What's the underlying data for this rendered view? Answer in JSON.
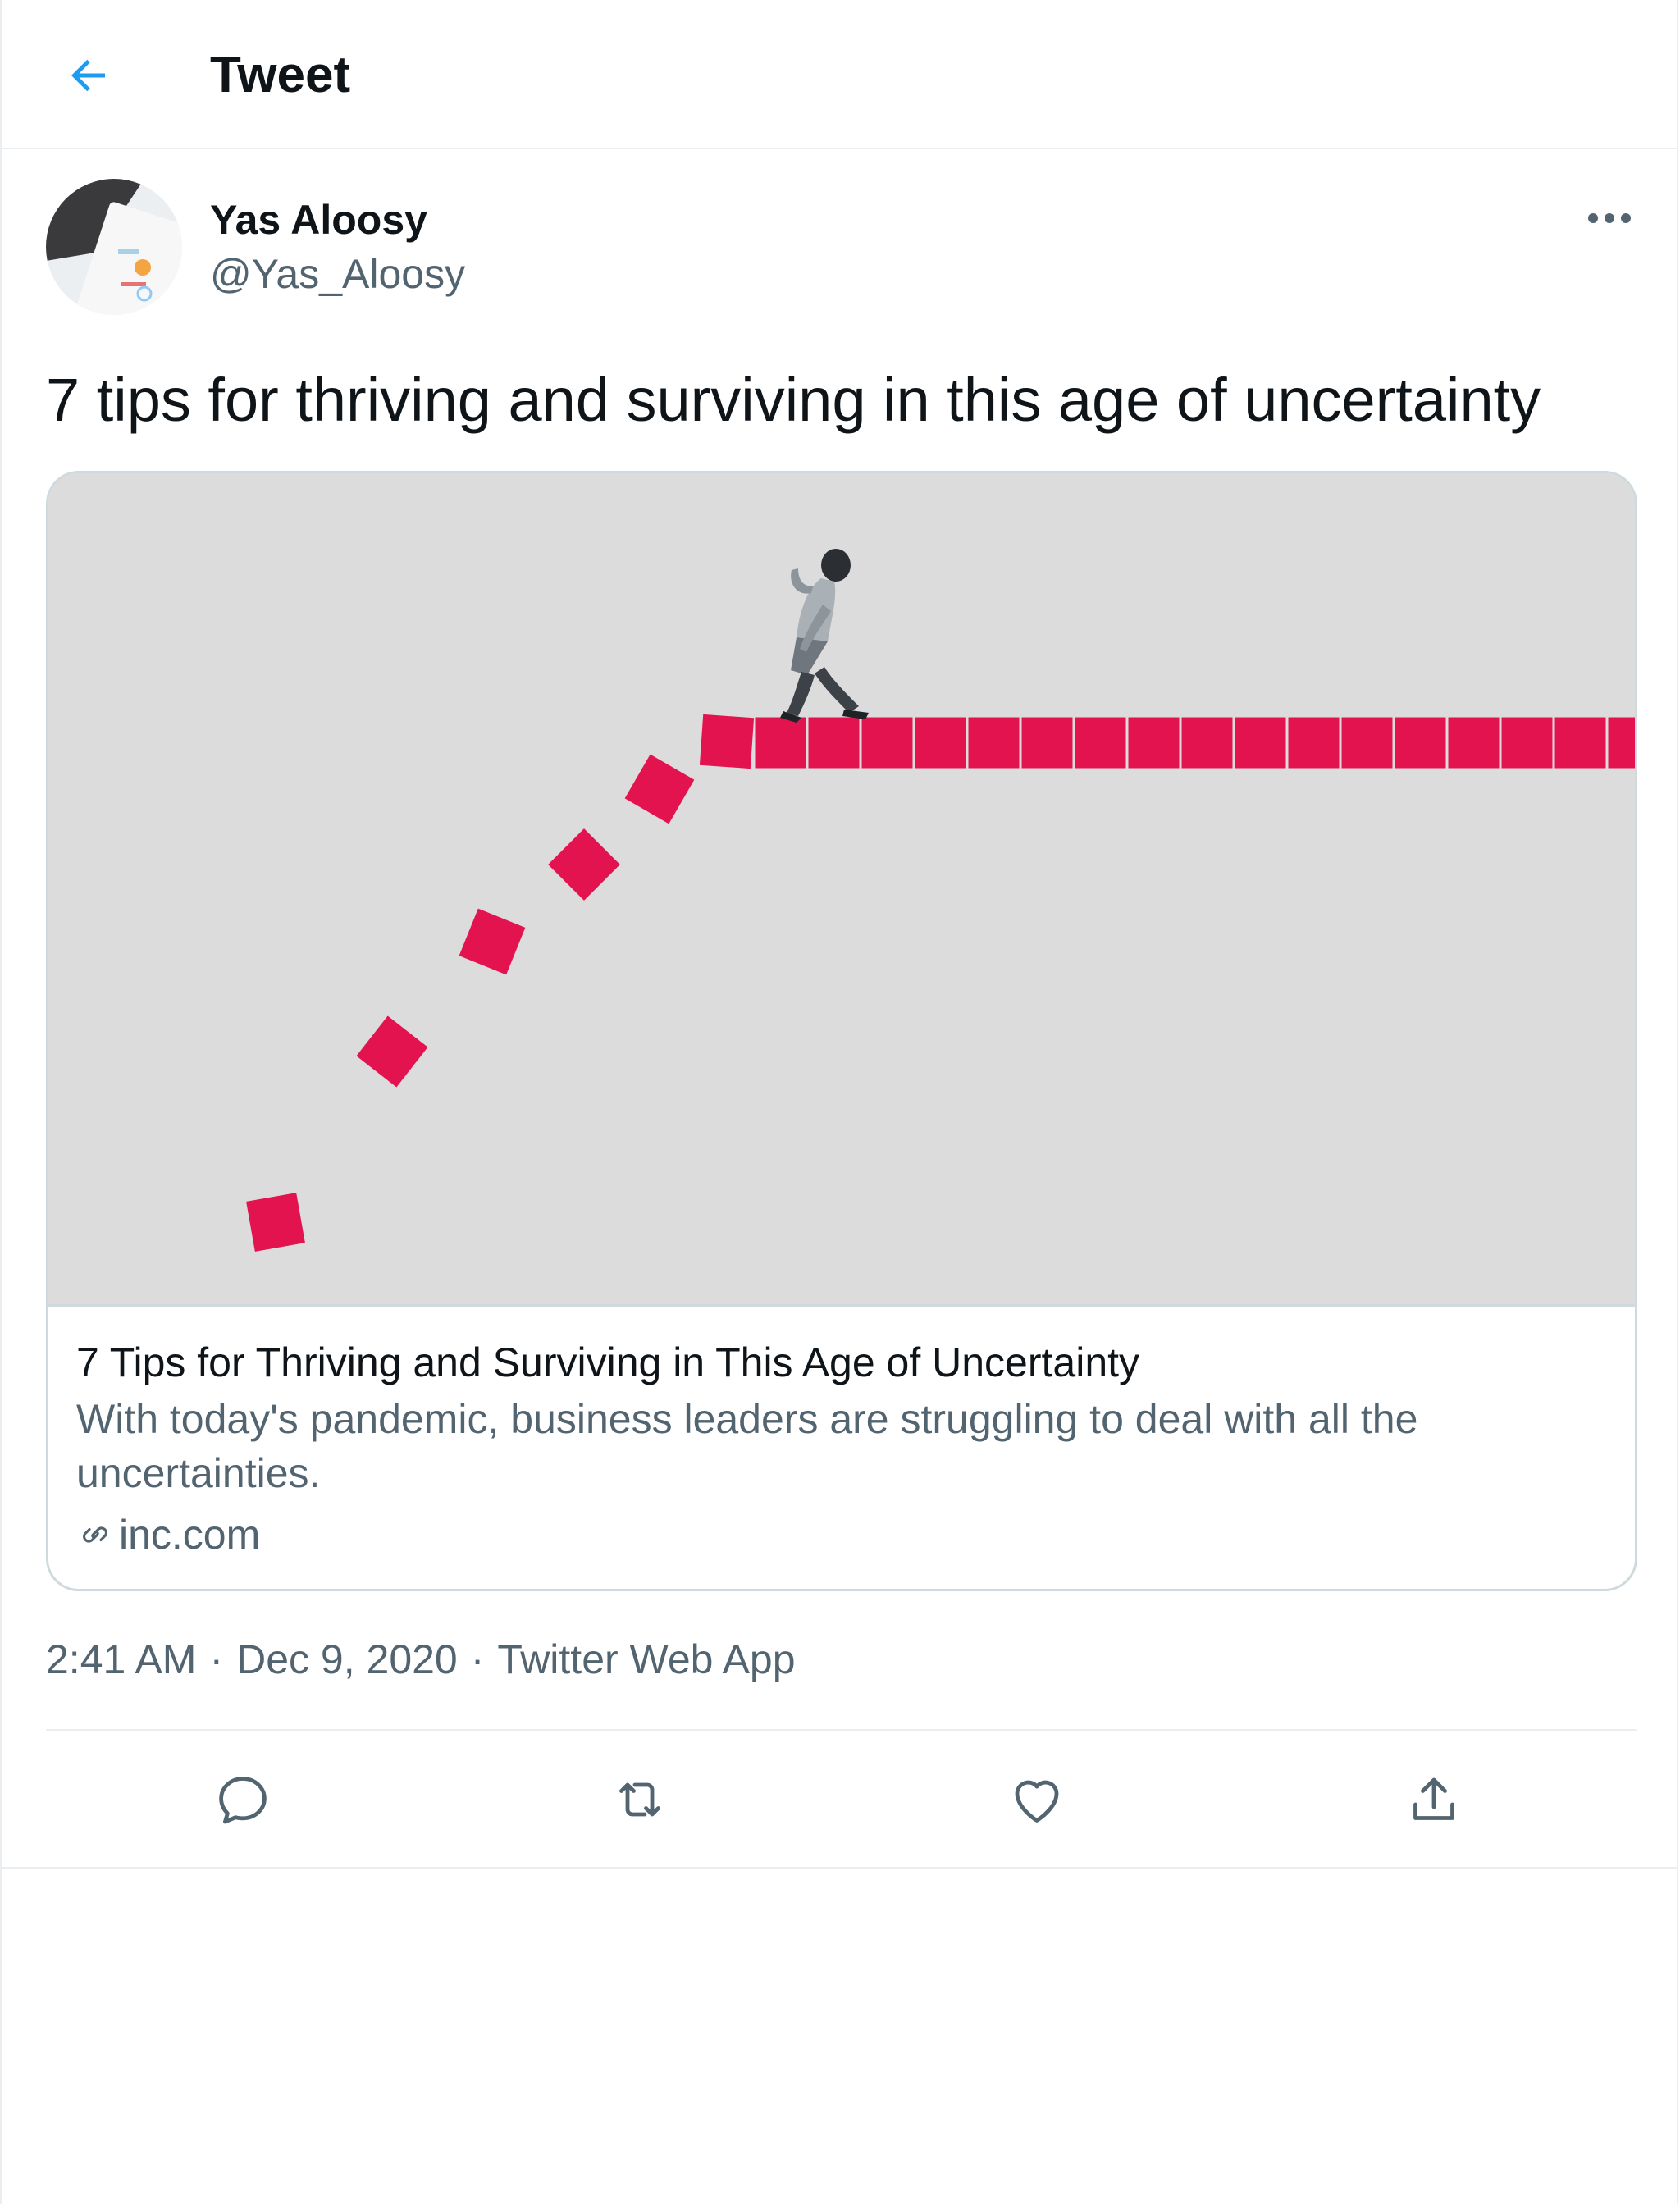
{
  "header": {
    "title": "Tweet",
    "back_icon": "arrow-left-icon",
    "accent_color": "#1d9bf0"
  },
  "user": {
    "name": "Yas Aloosy",
    "handle": "@Yas_Aloosy"
  },
  "tweet": {
    "text": "7 tips for thriving and surviving in this age of uncertainty"
  },
  "card": {
    "title": "7 Tips for Thriving and Surviving in This Age of Uncertainty",
    "description": "With today's pandemic, business leaders are struggling to deal with all the uncertainties.",
    "domain": "inc.com",
    "image_accent": "#e3134f",
    "image_background": "#dcdcdc"
  },
  "meta": {
    "time": "2:41 AM",
    "date": "Dec 9, 2020",
    "source": "Twitter Web App"
  },
  "actions": {
    "icons": [
      "reply-icon",
      "retweet-icon",
      "like-icon",
      "share-icon"
    ]
  }
}
